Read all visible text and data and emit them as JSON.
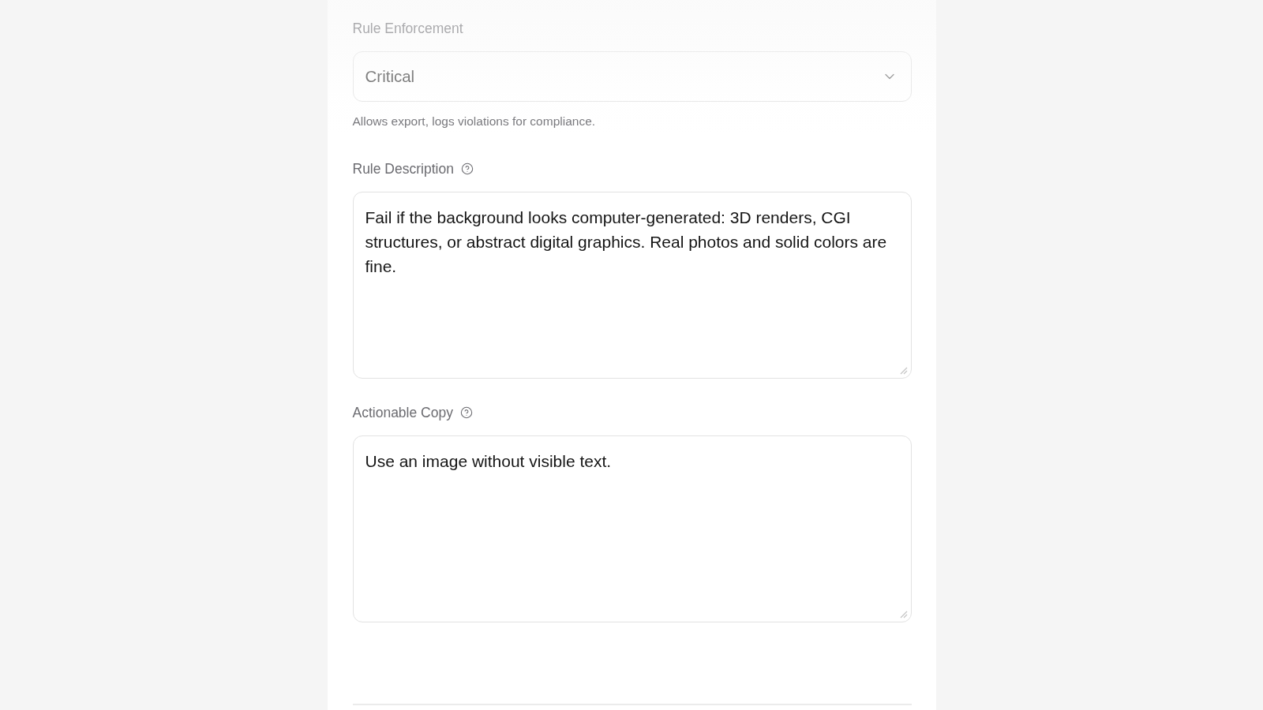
{
  "fields": [
    {
      "kind": "select",
      "label": "Rule Enforcement",
      "help_icon": false,
      "value": "Critical",
      "helper": "Allows export, logs violations for compliance."
    },
    {
      "kind": "textarea",
      "label": "Rule Description",
      "help_icon": true,
      "value": "Fail if the background looks computer-generated: 3D renders, CGI structures, or abstract digital graphics. Real photos and solid colors are fine."
    },
    {
      "kind": "textarea",
      "label": "Actionable Copy",
      "help_icon": true,
      "value": "Use an image without visible text."
    }
  ]
}
